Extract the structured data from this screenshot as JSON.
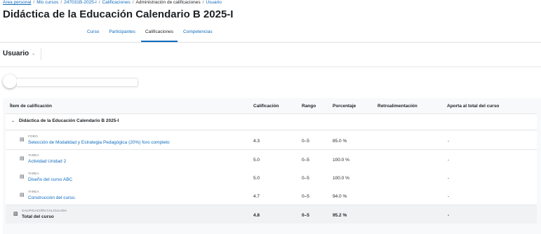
{
  "breadcrumb": {
    "items": [
      "Área personal",
      "Mis cursos",
      "247031B-2025-I",
      "Calificaciones",
      "Administración de calificaciones",
      "Usuario"
    ],
    "separator": "/"
  },
  "page_title": "Didáctica de la Educación Calendario B 2025-I",
  "tabs": [
    {
      "label": "Curso",
      "active": false
    },
    {
      "label": "Participantes",
      "active": false
    },
    {
      "label": "Calificaciones",
      "active": true
    },
    {
      "label": "Competencias",
      "active": false
    }
  ],
  "user_select": {
    "label": "Usuario",
    "icon": "chevron-down-icon"
  },
  "search": {
    "value": "",
    "placeholder": ""
  },
  "report": {
    "columns": [
      "Ítem de calificación",
      "Calificación",
      "Rango",
      "Porcentaje",
      "Retroalimentación",
      "Aporta al total del curso"
    ],
    "category": {
      "name": "Didáctica de la Educación Calendario B 2025-I",
      "expanded": true,
      "icon": "chevron-down-icon"
    },
    "items": [
      {
        "type": "FORO",
        "icon": "forum-icon",
        "name": "Selección de Modalidad y Estrategia Pedagógica (20%) foro completo",
        "grade": "4.3",
        "range": "0–5",
        "percentage": "85.0 %",
        "feedback": "",
        "contribution": "-"
      },
      {
        "type": "TAREA",
        "icon": "assignment-icon",
        "name": "Actividad Unidad 2",
        "grade": "5.0",
        "range": "0–5",
        "percentage": "100.0 %",
        "feedback": "",
        "contribution": "-"
      },
      {
        "type": "TAREA",
        "icon": "assignment-icon",
        "name": "Diseño del curso ABC",
        "grade": "5.0",
        "range": "0–5",
        "percentage": "100.0 %",
        "feedback": "",
        "contribution": "-"
      },
      {
        "type": "TAREA",
        "icon": "assignment-icon",
        "name": "Construcción del curso.",
        "grade": "4.7",
        "range": "0–5",
        "percentage": "94.0 %",
        "feedback": "",
        "contribution": "-"
      }
    ],
    "total": {
      "type": "CALIFICACIÓN CALCULADA",
      "icon": "calculator-icon",
      "name": "Total del curso",
      "grade": "4.8",
      "range": "0–5",
      "percentage": "95.2 %",
      "feedback": "",
      "contribution": "-"
    }
  },
  "colors": {
    "link": "#0f6cbf",
    "text": "#1d2125",
    "muted": "#6a737b",
    "report_bg": "#f8f9fa",
    "total_bg": "#f1f2f4"
  }
}
